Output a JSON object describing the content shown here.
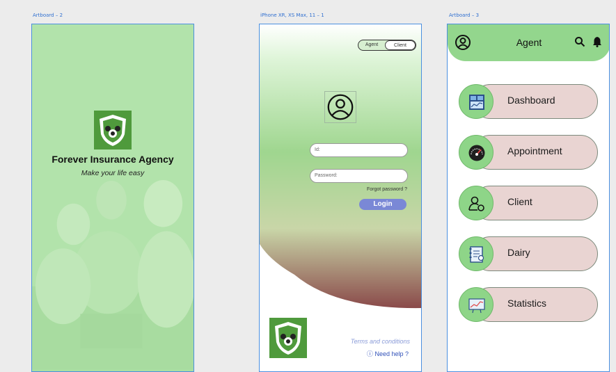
{
  "artboards": {
    "ab2_label": "Artboard – 2",
    "iphone_label": "iPhone XR, XS Max, 11 – 1",
    "ab3_label": "Artboard – 3"
  },
  "splash": {
    "title": "Forever Insurance Agency",
    "subtitle": "Make your life easy"
  },
  "login": {
    "toggle_agent": "Agent",
    "toggle_client": "Client",
    "id_placeholder": "Id:",
    "password_placeholder": "Password:",
    "forgot": "Forgot password ?",
    "login_button": "Login",
    "terms": "Terms and conditions",
    "help": "Need help ?"
  },
  "agent": {
    "title": "Agent",
    "menu": [
      {
        "label": "Dashboard",
        "icon": "dashboard-icon"
      },
      {
        "label": "Appointment",
        "icon": "speedometer-icon"
      },
      {
        "label": "Client",
        "icon": "client-search-icon"
      },
      {
        "label": "Dairy",
        "icon": "diary-icon"
      },
      {
        "label": "Statistics",
        "icon": "statistics-icon"
      }
    ]
  },
  "colors": {
    "accent_green": "#93d68d",
    "pill": "#e9d4d2",
    "login_button": "#7a88d6",
    "frame_border": "#4a8fe0"
  }
}
